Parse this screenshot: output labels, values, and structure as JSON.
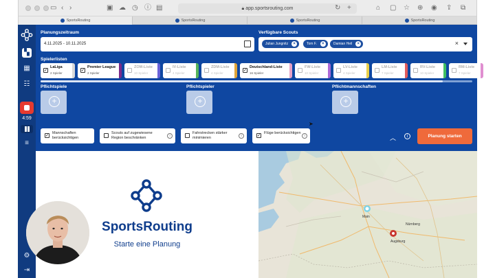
{
  "browser": {
    "url": "app.sportsrouting.com",
    "tabs": [
      "SportsRouting",
      "SportsRouting",
      "SportsRouting",
      "SportsRouting"
    ]
  },
  "recording": {
    "time": "4:59"
  },
  "planning": {
    "date_label": "Planungszeitraum",
    "date_value": "4.11.2025 - 10.11.2025",
    "scouts_label": "Verfügbare Scouts",
    "scouts": [
      "Julian Jungnitz",
      "Tom F.",
      "Damian Heil"
    ],
    "lists_label": "Spielerlisten",
    "lists": [
      {
        "name": "LaLiga",
        "count": "2 Spieler",
        "checked": "✓",
        "color": "#d9d9d9"
      },
      {
        "name": "Premier League",
        "count": "2 Spieler",
        "checked": "✓",
        "color": "#7c2a8a"
      },
      {
        "name": "ZOM-Liste",
        "count": "10 Spieler",
        "checked": "",
        "color": "#6a63d9"
      },
      {
        "name": "IV-Liste",
        "count": "4 Spieler",
        "checked": "",
        "color": "#55b35a"
      },
      {
        "name": "ZDM-Liste",
        "count": "4 Spieler",
        "checked": "",
        "color": "#e0a43a"
      },
      {
        "name": "Deutschland-Liste",
        "count": "16 Spieler",
        "checked": "✓",
        "color": "#e8a2c6"
      },
      {
        "name": "FW-Liste",
        "count": "10 Spieler",
        "checked": "",
        "color": "#ac6ad8"
      },
      {
        "name": "LV-Liste",
        "count": "4 Spieler",
        "checked": "",
        "color": "#e9cf4a"
      },
      {
        "name": "LM-Liste",
        "count": "7 Spieler",
        "checked": "",
        "color": "#e25c5c"
      },
      {
        "name": "RV-Liste",
        "count": "10 Spieler",
        "checked": "",
        "color": "#3fbf62"
      },
      {
        "name": "RM-Liste",
        "count": "7 Spieler",
        "checked": "",
        "color": "#e08fd0"
      }
    ],
    "required_games_label": "Pflichtspiele",
    "required_players_label": "Pflichtspieler",
    "required_teams_label": "Pflichtmannschaften",
    "options": [
      {
        "label": "Mannschaften berücksichtigen",
        "checked": "✓"
      },
      {
        "label": "Scouts auf zugewiesene Region beschränken",
        "checked": ""
      },
      {
        "label": "Fahrstrecken stärker minimieren",
        "checked": ""
      },
      {
        "label": "Flüge berücksichtigen",
        "checked": "✓"
      }
    ],
    "start_button": "Planung starten"
  },
  "hero": {
    "brand": "SportsRouting",
    "subtitle": "Starte eine Planung"
  },
  "map": {
    "cities": [
      "Main",
      "Nürnberg",
      "Augsburg"
    ]
  },
  "colors": {
    "brand_blue": "#0f47a1",
    "accent_orange": "#ef6a3b",
    "chip_blue": "#1d4fa0"
  }
}
